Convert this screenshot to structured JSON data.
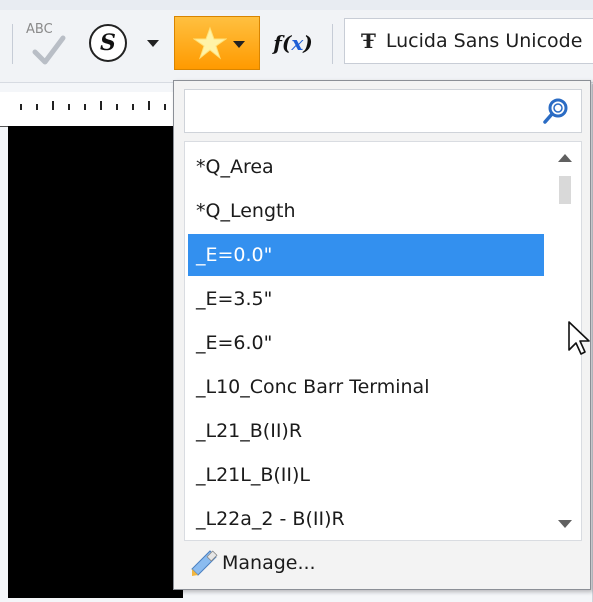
{
  "toolbar": {
    "spell_text": "ABC",
    "symbol_letter": "S",
    "fx_label_f": "f(",
    "fx_label_x": "x",
    "fx_label_close": ")",
    "font_icon": "Ŧ",
    "font_name": "Lucida Sans Unicode",
    "favorite_color": "#ff9a00"
  },
  "popup": {
    "search_placeholder": "",
    "search_value": "",
    "items": [
      {
        "label": "*Q_Area",
        "selected": false
      },
      {
        "label": "*Q_Length",
        "selected": false
      },
      {
        "label": "_E=0.0\"",
        "selected": true
      },
      {
        "label": "_E=3.5\"",
        "selected": false
      },
      {
        "label": "_E=6.0\"",
        "selected": false
      },
      {
        "label": "_L10_Conc Barr Terminal",
        "selected": false
      },
      {
        "label": "_L21_B(II)R",
        "selected": false
      },
      {
        "label": "_L21L_B(II)L",
        "selected": false
      },
      {
        "label": "_L22a_2 - B(II)R",
        "selected": false
      }
    ],
    "selection_color": "#3390ef",
    "footer_label": "Manage..."
  },
  "icons": [
    "spell-check-icon",
    "symbol-s-icon",
    "star-icon",
    "function-icon",
    "font-icon",
    "search-icon",
    "pencil-icon",
    "cursor-icon"
  ]
}
